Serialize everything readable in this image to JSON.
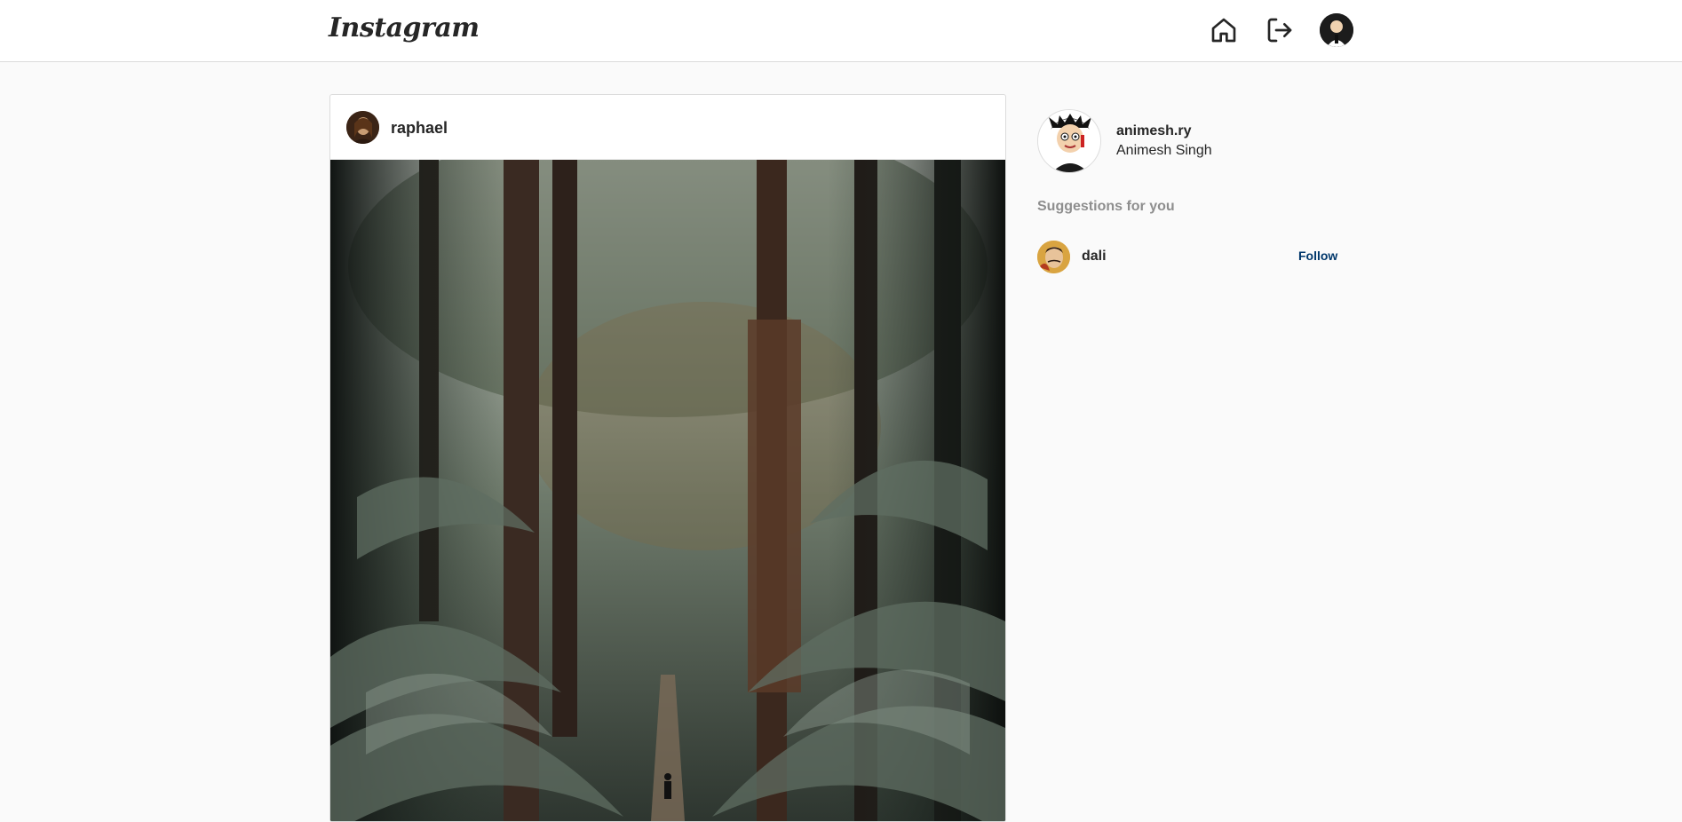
{
  "header": {
    "logo_text": "Instagram",
    "icons": [
      "home-icon",
      "logout-icon",
      "user-avatar"
    ]
  },
  "post": {
    "username": "raphael",
    "avatar_color": "#4a2e1e"
  },
  "sidebar": {
    "profile": {
      "username": "animesh.ry",
      "full_name": "Animesh Singh"
    },
    "suggestions_title": "Suggestions for you",
    "suggestions": [
      {
        "username": "dali",
        "action": "Follow"
      }
    ]
  },
  "colors": {
    "background": "#fafafa",
    "border": "#dbdbdb",
    "follow": "#00376b",
    "muted": "#8e8e8e"
  }
}
